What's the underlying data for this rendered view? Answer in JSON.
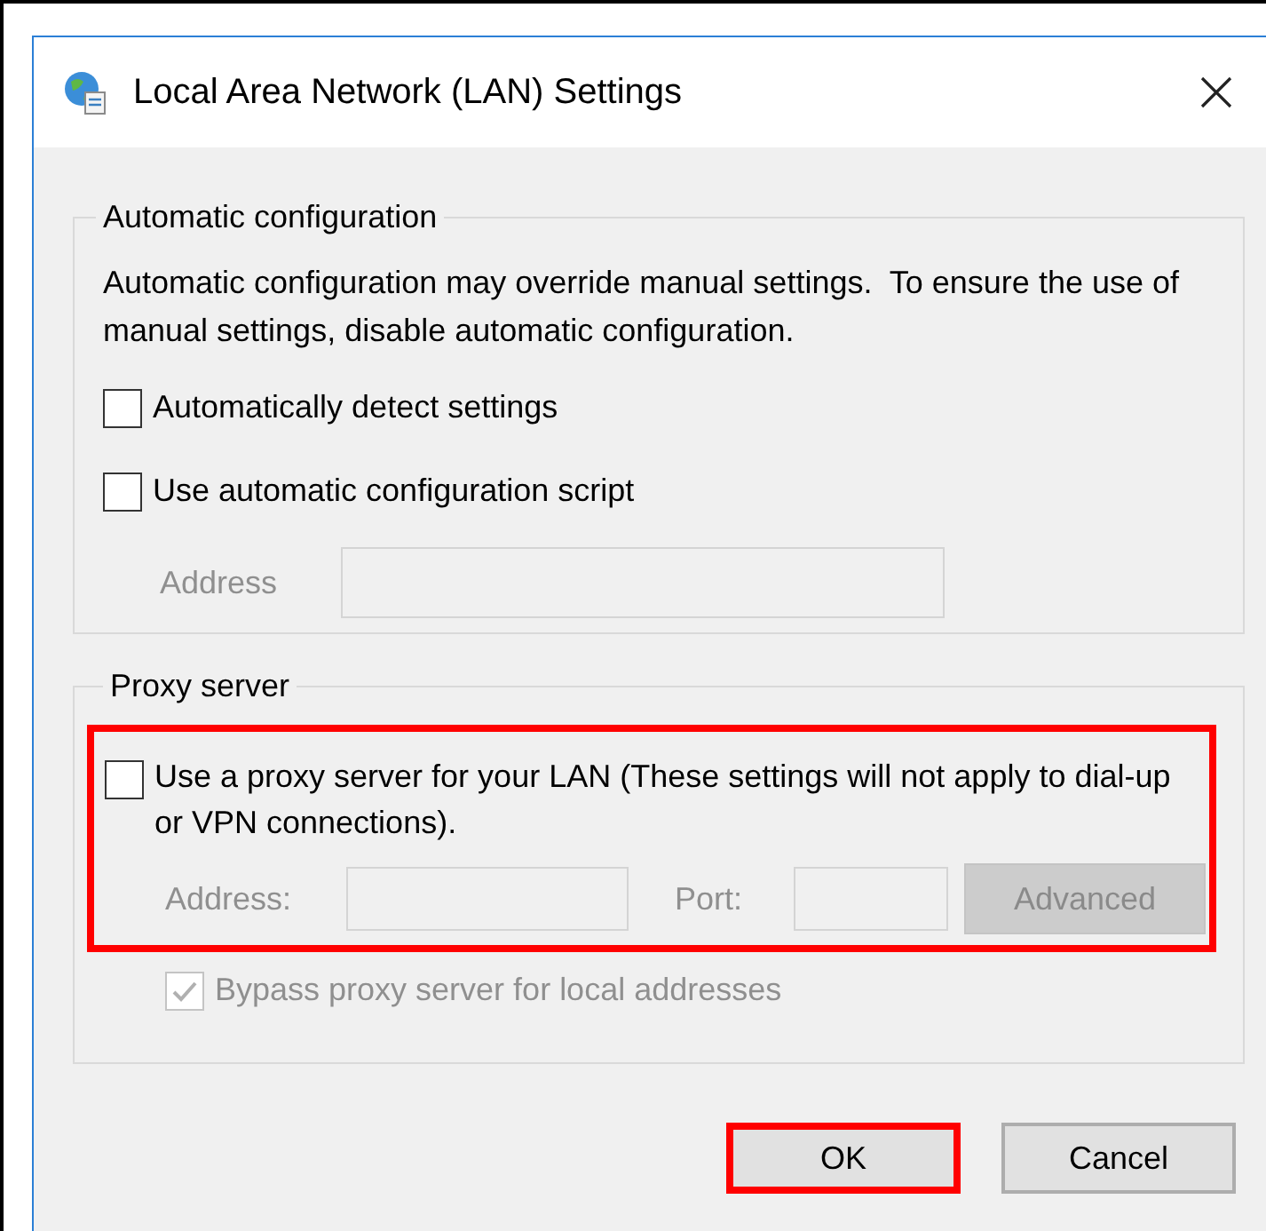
{
  "window": {
    "title": "Local Area Network (LAN) Settings"
  },
  "automatic_configuration": {
    "title": "Automatic configuration",
    "description": "Automatic configuration may override manual settings.  To ensure the use of manual settings, disable automatic configuration.",
    "options": [
      {
        "label": "Automatically detect settings",
        "checked": false
      },
      {
        "label": "Use automatic configuration script",
        "checked": false
      }
    ],
    "address": {
      "label": "Address",
      "disabled": true
    }
  },
  "proxy_server": {
    "title": "Proxy server",
    "highlighted": true,
    "use_proxy": {
      "label": "Use a proxy server for your LAN (These settings will not apply to dial-up or VPN connections).",
      "checked": false
    },
    "address": {
      "label": "Address:",
      "disabled": true
    },
    "port": {
      "label": "Port:",
      "disabled": true
    },
    "advanced_button": {
      "label": "Advanced",
      "disabled": true
    },
    "bypass": {
      "label": "Bypass proxy server for local addresses",
      "checked": true,
      "disabled": true
    }
  },
  "buttons": [
    {
      "label": "OK",
      "highlighted": true
    },
    {
      "label": "Cancel",
      "highlighted": false
    }
  ]
}
